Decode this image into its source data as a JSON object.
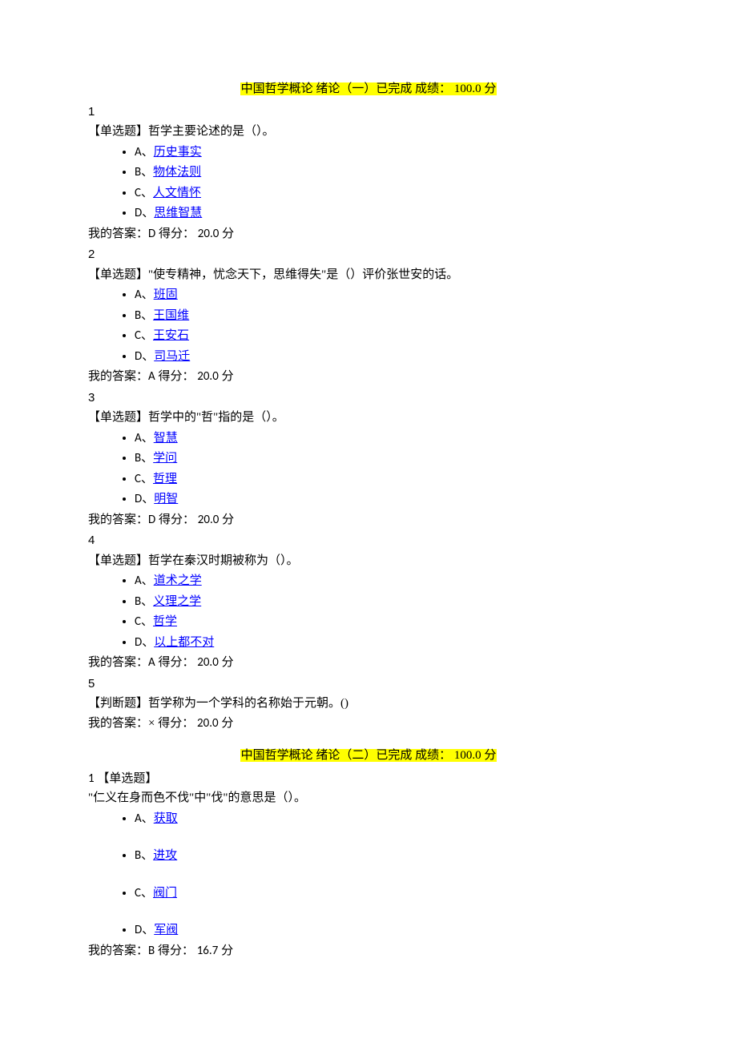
{
  "section1": {
    "title": "中国哲学概论 绪论（一）已完成 成绩： 100.0 分",
    "questions": [
      {
        "num": "1",
        "type": "【单选题】",
        "text": "哲学主要论述的是（）。",
        "options": [
          {
            "label": "A、",
            "text": "历史事实"
          },
          {
            "label": "B、",
            "text": "物体法则"
          },
          {
            "label": "C、",
            "text": "人文情怀"
          },
          {
            "label": "D、",
            "text": "思维智慧"
          }
        ],
        "answer_prefix": "我的答案：",
        "answer_val": "D",
        "score_prefix": " 得分： ",
        "score_val": "20.0",
        "score_suffix": " 分"
      },
      {
        "num": "2",
        "type": "【单选题】",
        "text": "\"使专精神，忧念天下，思维得失\"是（）评价张世安的话。",
        "options": [
          {
            "label": "A、",
            "text": "班固"
          },
          {
            "label": "B、",
            "text": "王国维"
          },
          {
            "label": "C、",
            "text": "王安石"
          },
          {
            "label": "D、",
            "text": "司马迁"
          }
        ],
        "answer_prefix": "我的答案：",
        "answer_val": "A",
        "score_prefix": " 得分： ",
        "score_val": "20.0",
        "score_suffix": " 分"
      },
      {
        "num": "3",
        "type": "【单选题】",
        "text": "哲学中的\"哲\"指的是（）。",
        "options": [
          {
            "label": "A、",
            "text": "智慧"
          },
          {
            "label": "B、",
            "text": "学问"
          },
          {
            "label": "C、",
            "text": "哲理"
          },
          {
            "label": "D、",
            "text": "明智"
          }
        ],
        "answer_prefix": "我的答案：",
        "answer_val": "D",
        "score_prefix": " 得分： ",
        "score_val": "20.0",
        "score_suffix": " 分"
      },
      {
        "num": "4",
        "type": "【单选题】",
        "text": "哲学在秦汉时期被称为（）。",
        "options": [
          {
            "label": "A、",
            "text": "道术之学"
          },
          {
            "label": "B、",
            "text": "义理之学"
          },
          {
            "label": "C、",
            "text": "哲学"
          },
          {
            "label": "D、",
            "text": "以上都不对"
          }
        ],
        "answer_prefix": "我的答案：",
        "answer_val": "A",
        "score_prefix": " 得分： ",
        "score_val": "20.0",
        "score_suffix": " 分"
      },
      {
        "num": "5",
        "type": "【判断题】",
        "text": "哲学称为一个学科的名称始于元朝。()",
        "options": [],
        "answer_prefix": "我的答案：",
        "answer_val": "×",
        "score_prefix": " 得分： ",
        "score_val": "20.0",
        "score_suffix": " 分"
      }
    ]
  },
  "section2": {
    "title": "中国哲学概论 绪论（二）已完成 成绩： 100.0 分",
    "q1": {
      "num": "1",
      "type": "【单选题】",
      "text": "\"仁义在身而色不伐\"中\"伐\"的意思是（）。",
      "options": [
        {
          "label": "A、",
          "text": "获取"
        },
        {
          "label": "B、",
          "text": "进攻"
        },
        {
          "label": "C、",
          "text": "阀门"
        },
        {
          "label": "D、",
          "text": "军阀"
        }
      ],
      "answer_prefix": "我的答案：",
      "answer_val": "B",
      "score_prefix": " 得分： ",
      "score_val": "16.7",
      "score_suffix": " 分"
    }
  }
}
